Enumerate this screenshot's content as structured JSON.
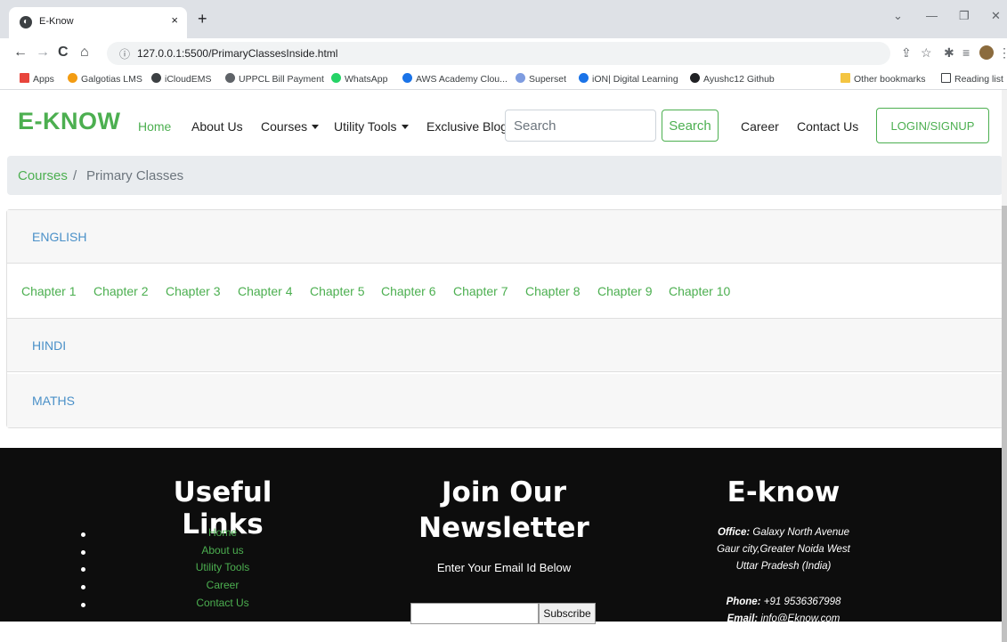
{
  "browser": {
    "tab_title": "E-Know",
    "tab_close": "×",
    "new_tab": "+",
    "url": "127.0.0.1:5500/PrimaryClassesInside.html",
    "bookmarks": [
      {
        "label": "Apps",
        "color": "#e8453c"
      },
      {
        "label": "Galgotias LMS",
        "color": "#f39c12"
      },
      {
        "label": "iCloudEMS",
        "color": "#3c4043"
      },
      {
        "label": "UPPCL Bill Payment",
        "color": "#5f6368"
      },
      {
        "label": "WhatsApp",
        "color": "#25d366"
      },
      {
        "label": "AWS Academy Clou...",
        "color": "#1a73e8"
      },
      {
        "label": "Superset",
        "color": "#7e9ce0"
      },
      {
        "label": "iON| Digital Learning",
        "color": "#1a73e8"
      },
      {
        "label": "Ayushc12 Github",
        "color": "#202124"
      }
    ],
    "other_bookmarks": "Other bookmarks",
    "reading_list": "Reading list"
  },
  "navbar": {
    "brand": "E-KNOW",
    "links": {
      "home": "Home",
      "about": "About Us",
      "courses": "Courses",
      "utility": "Utility Tools",
      "blogs": "Exclusive Blogs",
      "career": "Career",
      "contact": "Contact Us"
    },
    "search_placeholder": "Search",
    "search_button": "Search",
    "login_button": "LOGIN/SIGNUP",
    "brand_color": "#4caf50"
  },
  "breadcrumb": {
    "parent": "Courses",
    "separator": "/",
    "current": "Primary Classes"
  },
  "accordion": {
    "sections": [
      "ENGLISH",
      "HINDI",
      "MATHS"
    ],
    "chapters": [
      "Chapter 1",
      "Chapter 2",
      "Chapter 3",
      "Chapter 4",
      "Chapter 5",
      "Chapter 6",
      "Chapter 7",
      "Chapter 8",
      "Chapter 9",
      "Chapter 10"
    ]
  },
  "footer": {
    "useful_links_title": "Useful Links",
    "useful_links": [
      "Home",
      "About us",
      "Utility Tools",
      "Career",
      "Contact Us"
    ],
    "newsletter_title_line1": "Join Our",
    "newsletter_title_line2": "Newsletter",
    "newsletter_label": "Enter Your Email Id Below",
    "subscribe_button": "Subscribe",
    "brand_title": "E-know",
    "office_label": "Office:",
    "office_line1": "Galaxy North Avenue",
    "office_line2": "Gaur city,Greater Noida West",
    "office_line3": "Uttar Pradesh (India)",
    "phone_label": "Phone:",
    "phone": "+91 9536367998",
    "email_label": "Email:",
    "email": "info@Eknow.com"
  }
}
